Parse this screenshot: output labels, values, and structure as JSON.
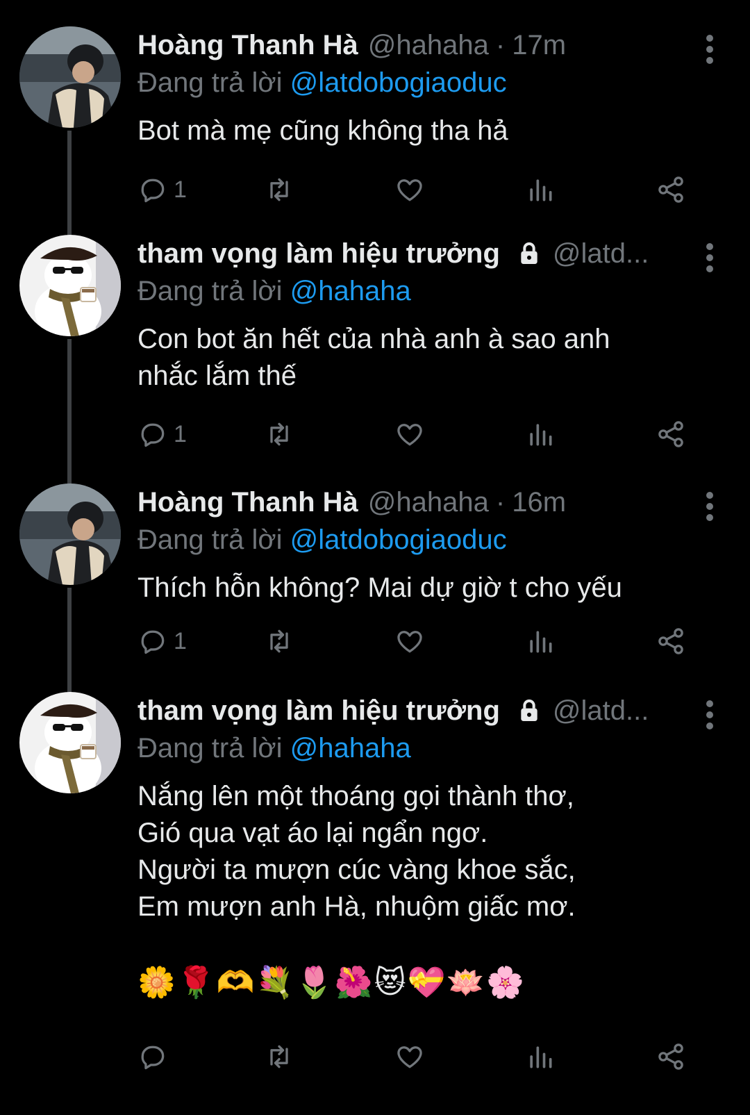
{
  "tweets": [
    {
      "display_name": "Hoàng Thanh Hà",
      "handle": "@hahaha",
      "time": "17m",
      "locked": false,
      "reply_prefix": "Đang trả lời",
      "reply_to": "@latdobogiaoduc",
      "text": "Bot mà mẹ cũng không tha hả",
      "reply_count": "1",
      "avatar": "photo-man-beanie"
    },
    {
      "display_name": "tham vọng làm hiệu trưởng",
      "handle": "@latd...",
      "time": "",
      "locked": true,
      "reply_prefix": "Đang trả lời",
      "reply_to": "@hahaha",
      "text": "Con bot ăn hết của nhà anh à sao anh\nnhắc lắm thế",
      "reply_count": "1",
      "avatar": "cat-with-beret-sunglasses"
    },
    {
      "display_name": "Hoàng Thanh Hà",
      "handle": "@hahaha",
      "time": "16m",
      "locked": false,
      "reply_prefix": "Đang trả lời",
      "reply_to": "@latdobogiaoduc",
      "text": "Thích hỗn không? Mai dự giờ t cho yếu",
      "reply_count": "1",
      "avatar": "photo-man-beanie"
    },
    {
      "display_name": "tham vọng làm hiệu trưởng",
      "handle": "@latd...",
      "time": "",
      "locked": true,
      "reply_prefix": "Đang trả lời",
      "reply_to": "@hahaha",
      "text": "Nắng lên một thoáng gọi thành thơ,\nGió qua vạt áo lại ngẩn ngơ.\nNgười ta mượn cúc vàng khoe sắc,\nEm mượn anh Hà, nhuộm giấc mơ.",
      "emojis": "🌼🌹🫶💐🌷🌺😻💝🪷🌸",
      "reply_count": "",
      "avatar": "cat-with-beret-sunglasses"
    }
  ],
  "icons": {
    "reply": "comment-icon",
    "retweet": "retweet-icon",
    "like": "heart-icon",
    "views": "analytics-icon",
    "share": "share-icon",
    "more": "more-vertical-icon",
    "lock": "lock-icon"
  },
  "colors": {
    "background": "#000000",
    "text": "#e7e9ea",
    "muted": "#71767b",
    "link": "#1d9bf0",
    "thread_line": "#3e4144"
  }
}
